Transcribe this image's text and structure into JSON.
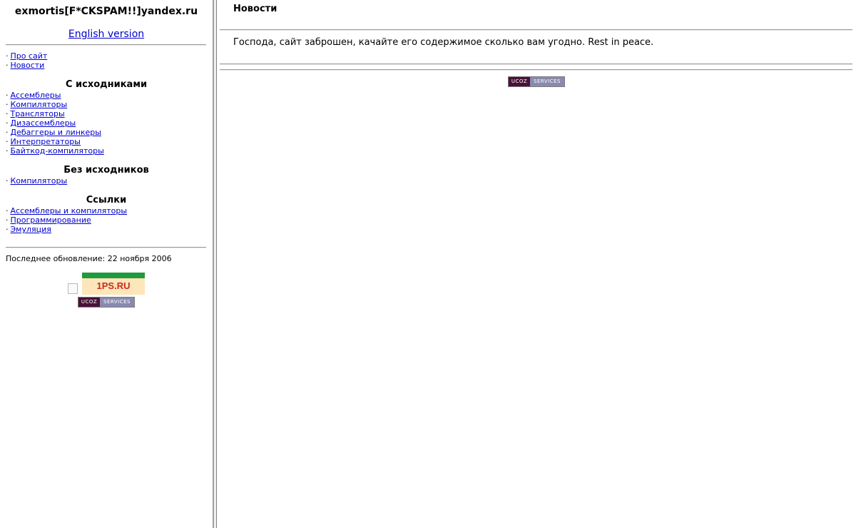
{
  "sidebar": {
    "email": "exmortis[F*CKSPAM!!]yandex.ru",
    "english_link": "English version",
    "main_menu": [
      {
        "label": "Про сайт"
      },
      {
        "label": "Новости"
      }
    ],
    "sections": [
      {
        "title": "С исходниками",
        "items": [
          {
            "label": "Ассемблеры"
          },
          {
            "label": "Компиляторы"
          },
          {
            "label": "Трансляторы"
          },
          {
            "label": "Дизассемблеры"
          },
          {
            "label": "Дебаггеры и линкеры"
          },
          {
            "label": "Интерпретаторы"
          },
          {
            "label": "Байткод-компиляторы"
          }
        ]
      },
      {
        "title": "Без исходников",
        "items": [
          {
            "label": "Компиляторы"
          }
        ]
      },
      {
        "title": "Ссылки",
        "items": [
          {
            "label": "Ассемблеры и компиляторы"
          },
          {
            "label": "Программирование"
          },
          {
            "label": "Эмуляция"
          }
        ]
      }
    ],
    "last_updated": "Последнее обновление: 22 ноября 2006",
    "banner_1ps": "1PS.RU",
    "ucoz_left": "UCOZ",
    "ucoz_right": "SERVICES"
  },
  "main": {
    "title": "Новости",
    "text": "Господа, сайт заброшен, качайте его содержимое сколько вам угодно. Rest in peace.",
    "ucoz_left": "UCOZ",
    "ucoz_right": "SERVICES"
  },
  "colors": {
    "link": "#0000cc",
    "frame_border": "#a0a0a0",
    "banner_green": "#1f9a3e",
    "banner_bg": "#fde6b9",
    "ucoz_dark": "#4a1137",
    "ucoz_light": "#8a8ab0"
  },
  "icons": [
    "broken-image-icon"
  ]
}
